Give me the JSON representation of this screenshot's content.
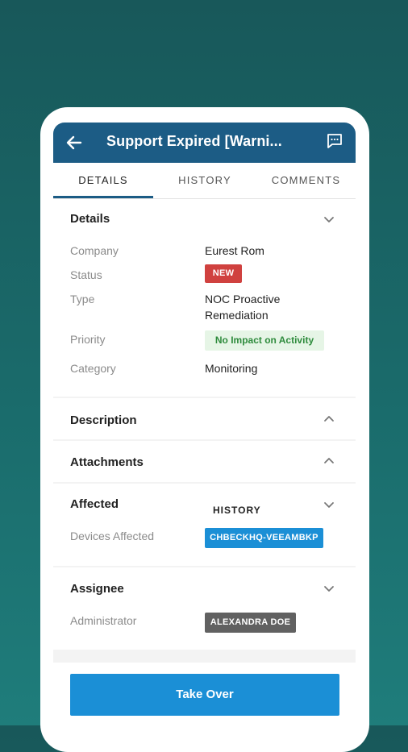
{
  "appbar": {
    "title": "Support Expired [Warni...",
    "back_icon": "arrow-left-icon",
    "chat_icon": "chat-bubble-icon"
  },
  "tabs": [
    {
      "label": "DETAILS",
      "active": true
    },
    {
      "label": "HISTORY",
      "active": false
    },
    {
      "label": "COMMENTS",
      "active": false
    }
  ],
  "details": {
    "title": "Details",
    "rows": {
      "company": {
        "label": "Company",
        "value": "Eurest Rom"
      },
      "status": {
        "label": "Status",
        "value": "NEW",
        "color": "#d0413f"
      },
      "type": {
        "label": "Type",
        "value_line1": "NOC Proactive",
        "value_line2": "Remediation"
      },
      "priority": {
        "label": "Priority",
        "value": "No Impact on Activity",
        "bg": "#e6f5e6",
        "color": "#2e8b3c"
      },
      "category": {
        "label": "Category",
        "value": "Monitoring"
      }
    }
  },
  "description": {
    "title": "Description"
  },
  "attachments": {
    "title": "Attachments"
  },
  "affected": {
    "title": "Affected",
    "history_label": "HISTORY",
    "devices_label": "Devices Affected",
    "device": "CHBECKHQ-VEEAMBKP",
    "device_color": "#1b8fd6"
  },
  "assignee": {
    "title": "Assignee",
    "role_label": "Administrator",
    "name": "ALEXANDRA DOE",
    "badge_color": "#616161"
  },
  "take_over": {
    "label": "Take Over",
    "color": "#1b8fd6"
  },
  "colors": {
    "appbar": "#1c5c85",
    "background": "#18585a"
  }
}
